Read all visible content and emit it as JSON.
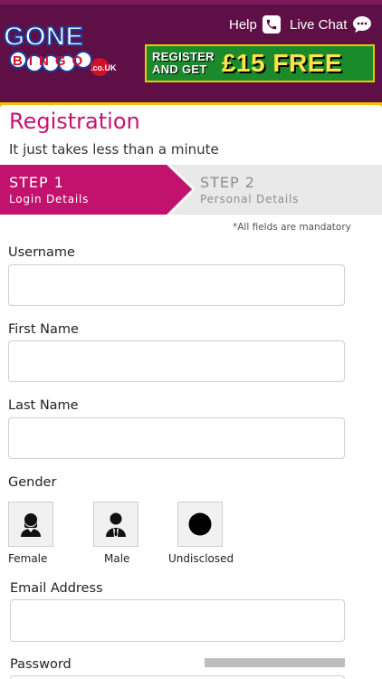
{
  "header": {
    "help_label": "Help",
    "chat_label": "Live Chat",
    "promo_line1": "REGISTER",
    "promo_line2": "AND GET",
    "promo_amount": "£15 FREE",
    "logo_text_1": "GONE",
    "logo_text_2": "BINGO",
    "logo_suffix": ".co.UK",
    "brand_color": "#5e0f45",
    "accent_color": "#c2126d"
  },
  "page": {
    "title": "Registration",
    "subtitle": "It just takes less than a minute",
    "mandatory_note": "*All fields are mandatory"
  },
  "steps": [
    {
      "title": "STEP 1",
      "subtitle": "Login Details",
      "active": true
    },
    {
      "title": "STEP 2",
      "subtitle": "Personal Details",
      "active": false
    }
  ],
  "form": {
    "username_label": "Username",
    "username_value": "",
    "firstname_label": "First Name",
    "firstname_value": "",
    "lastname_label": "Last Name",
    "lastname_value": "",
    "gender_label": "Gender",
    "gender_options": [
      {
        "label": "Female",
        "icon": "female-icon"
      },
      {
        "label": "Male",
        "icon": "male-icon"
      },
      {
        "label": "Undisclosed",
        "icon": "undisclosed-icon"
      }
    ],
    "email_label": "Email Address",
    "email_value": "",
    "password_label": "Password"
  }
}
